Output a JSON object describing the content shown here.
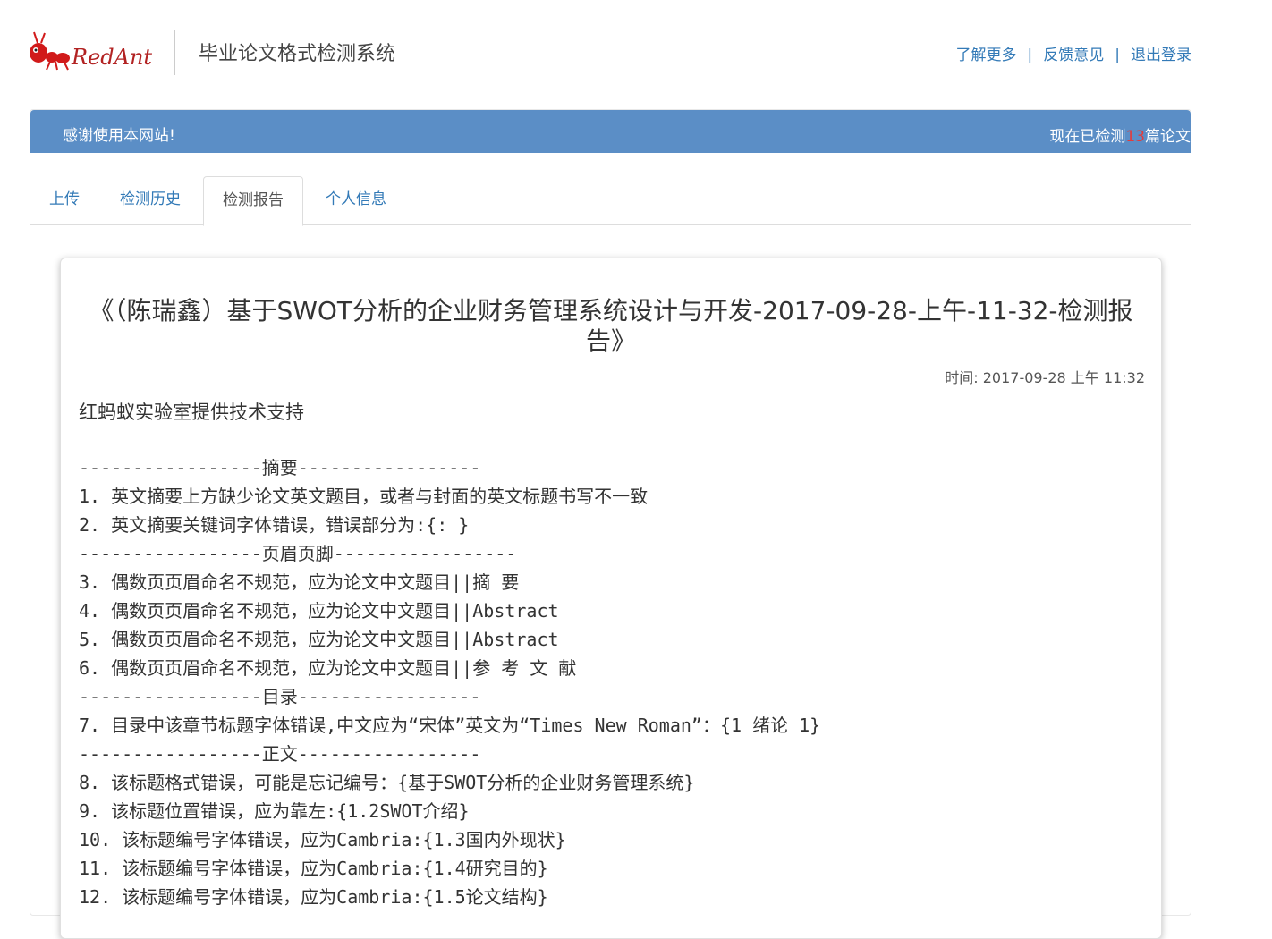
{
  "header": {
    "logo_text": "RedAnt",
    "system_title": "毕业论文格式检测系统",
    "links": [
      "了解更多",
      "反馈意见",
      "退出登录"
    ]
  },
  "banner": {
    "welcome": "感谢使用本网站!",
    "count_prefix": "现在已检测",
    "count": "13",
    "count_suffix": "篇论文"
  },
  "tabs": [
    "上传",
    "检测历史",
    "检测报告",
    "个人信息"
  ],
  "active_tab": "检测报告",
  "report": {
    "title": "《（陈瑞鑫）基于SWOT分析的企业财务管理系统设计与开发-2017-09-28-上午-11-32-检测报告》",
    "time": "时间: 2017-09-28 上午 11:32",
    "support": "红蚂蚁实验室提供技术支持",
    "lines": [
      "-----------------摘要-----------------",
      "1. 英文摘要上方缺少论文英文题目，或者与封面的英文标题书写不一致",
      "2. 英文摘要关键词字体错误，错误部分为:{: }",
      "-----------------页眉页脚-----------------",
      "3. 偶数页页眉命名不规范，应为论文中文题目||摘 要",
      "4. 偶数页页眉命名不规范，应为论文中文题目||Abstract",
      "5. 偶数页页眉命名不规范，应为论文中文题目||Abstract",
      "6. 偶数页页眉命名不规范，应为论文中文题目||参 考 文 献",
      "-----------------目录-----------------",
      "7. 目录中该章节标题字体错误,中文应为“宋体”英文为“Times New Roman”：{1 绪论 1}",
      "-----------------正文-----------------",
      "8. 该标题格式错误，可能是忘记编号：{基于SWOT分析的企业财务管理系统}",
      "9. 该标题位置错误，应为靠左:{1.2SWOT介绍}",
      "10. 该标题编号字体错误，应为Cambria:{1.3国内外现状}",
      "11. 该标题编号字体错误，应为Cambria:{1.4研究目的}",
      "12. 该标题编号字体错误，应为Cambria:{1.5论文结构}"
    ]
  },
  "colors": {
    "banner": "#5b8ec6",
    "link": "#337ab7",
    "count": "#e33b3b",
    "logo": "#d11a1a"
  }
}
